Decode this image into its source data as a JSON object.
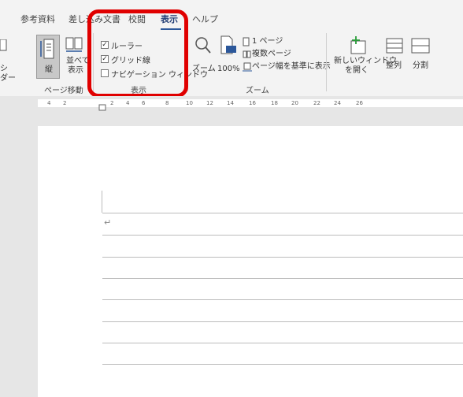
{
  "tabs": [
    "参考資料",
    "差し込み文書",
    "校閲",
    "表示",
    "ヘルプ"
  ],
  "active_tab": "表示",
  "groups": {
    "page_move": {
      "label": "ページ移動",
      "vertical_label": "縦",
      "side_by_side_label": [
        "並べて",
        "表示"
      ],
      "cut_label": [
        "シ",
        "ダー"
      ]
    },
    "show": {
      "label": "表示",
      "ruler": {
        "label": "ルーラー",
        "checked": true
      },
      "gridlines": {
        "label": "グリッド線",
        "checked": true
      },
      "nav_pane": {
        "label": "ナビゲーション ウィンドウ",
        "checked": false
      }
    },
    "zoom": {
      "label": "ズーム",
      "zoom_label": "ズーム",
      "hundred_label": "100%",
      "one_page": "1 ページ",
      "multi_page": "複数ページ",
      "page_width": "ページ幅を基準に表示"
    },
    "window": {
      "new_window": [
        "新しいウィンドウ",
        "を開く"
      ],
      "arrange": "整列",
      "split": "分割"
    }
  },
  "ruler_numbers": [
    "4",
    "2",
    "2",
    "4",
    "6",
    "8",
    "10",
    "12",
    "14",
    "16",
    "18",
    "20",
    "22",
    "24",
    "26"
  ],
  "document": {
    "return_mark": "↵"
  },
  "colors": {
    "highlight": "#e00000",
    "accent": "#2b579a"
  }
}
